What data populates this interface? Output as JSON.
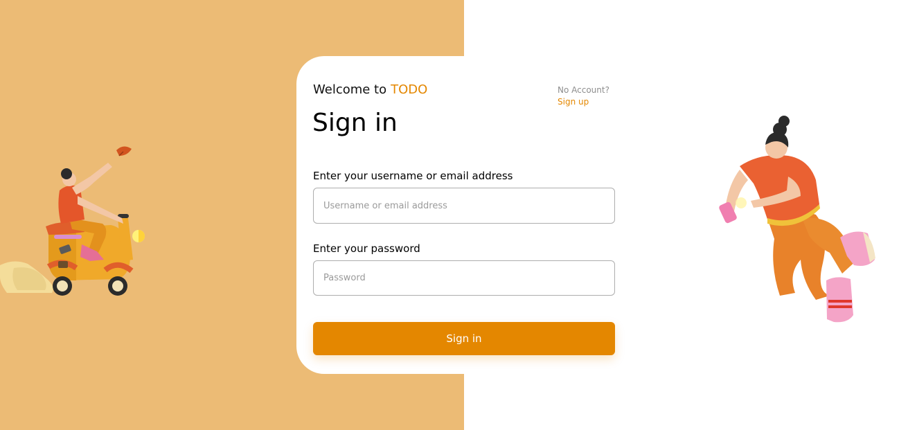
{
  "colors": {
    "left_panel": "#ecbb75",
    "accent": "#e48700",
    "card": "#ffffff"
  },
  "header": {
    "welcome_text": "Welcome to",
    "brand": "TODO",
    "no_account_text": "No Account?",
    "signup_link": "Sign up"
  },
  "form": {
    "title": "Sign in",
    "username_label": "Enter your username or email address",
    "username_placeholder": "Username or email address",
    "username_value": "",
    "password_label": "Enter your password",
    "password_placeholder": "Password",
    "password_value": "",
    "submit_label": "Sign in"
  },
  "illustrations": {
    "left": "scooter-rider-illustration",
    "right": "flying-woman-with-phone-illustration"
  }
}
